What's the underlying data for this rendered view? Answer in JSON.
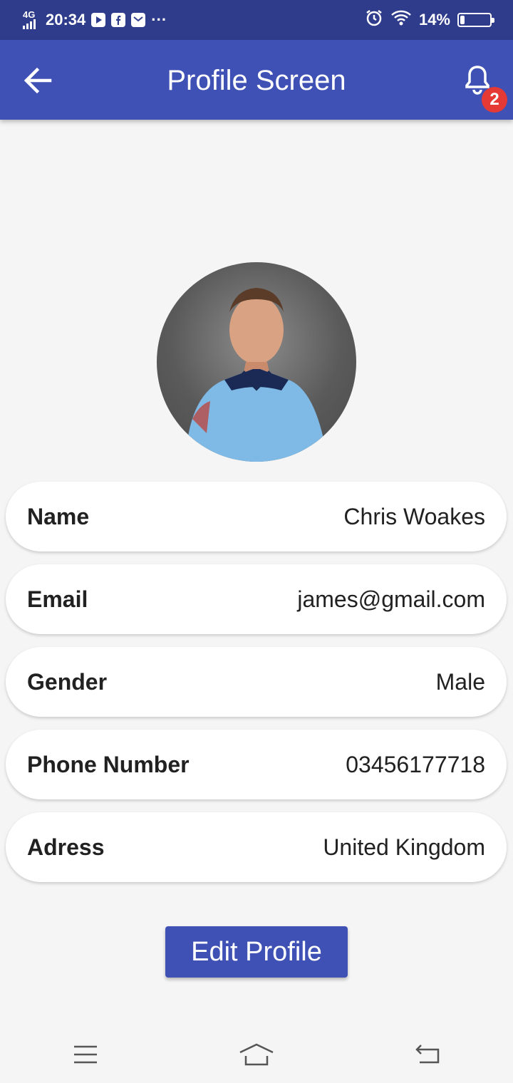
{
  "status_bar": {
    "network": "4G",
    "time": "20:34",
    "more": "···",
    "battery_text": "14%",
    "battery_level": 0.14,
    "icons": [
      "youtube-icon",
      "facebook-icon",
      "mail-icon",
      "alarm-icon",
      "wifi-icon",
      "battery-icon"
    ]
  },
  "app_bar": {
    "title": "Profile Screen",
    "notification_count": "2",
    "icons": [
      "back-arrow-icon",
      "bell-icon"
    ]
  },
  "profile": {
    "photo": "avatar-photo",
    "fields": [
      {
        "label": "Name",
        "value": "Chris Woakes"
      },
      {
        "label": "Email",
        "value": "james@gmail.com"
      },
      {
        "label": "Gender",
        "value": "Male"
      },
      {
        "label": "Phone Number",
        "value": "03456177718"
      },
      {
        "label": "Adress",
        "value": "United Kingdom"
      }
    ]
  },
  "actions": {
    "edit_label": "Edit Profile"
  },
  "nav_bar": {
    "icons": [
      "menu-icon",
      "home-icon",
      "back-icon"
    ]
  },
  "colors": {
    "status_bar": "#2f3c8c",
    "primary": "#3f51b5",
    "badge": "#e53935",
    "background": "#f5f5f5"
  }
}
